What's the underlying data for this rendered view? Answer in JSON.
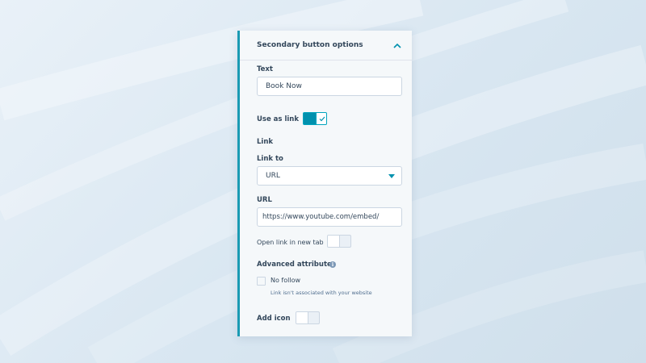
{
  "panel": {
    "title": "Secondary button options",
    "text_label": "Text",
    "text_value": "Book Now",
    "use_as_link_label": "Use as link",
    "use_as_link_on": true,
    "link_section_label": "Link",
    "link_to_label": "Link to",
    "link_to_value": "URL",
    "url_label": "URL",
    "url_value": "https://www.youtube.com/embed/",
    "open_new_tab_label": "Open link in new tab",
    "open_new_tab_on": false,
    "advanced_label": "Advanced attributes",
    "no_follow_label": "No follow",
    "no_follow_hint": "Link isn't associated with your website",
    "add_icon_label": "Add icon",
    "add_icon_on": false
  },
  "icons": {
    "collapse": "chevron-up-icon",
    "dropdown": "caret-down-icon",
    "info": "info-icon",
    "check": "check-icon"
  },
  "colors": {
    "accent": "#00a4bd",
    "accent_dark": "#0091ae",
    "text": "#33475b"
  }
}
